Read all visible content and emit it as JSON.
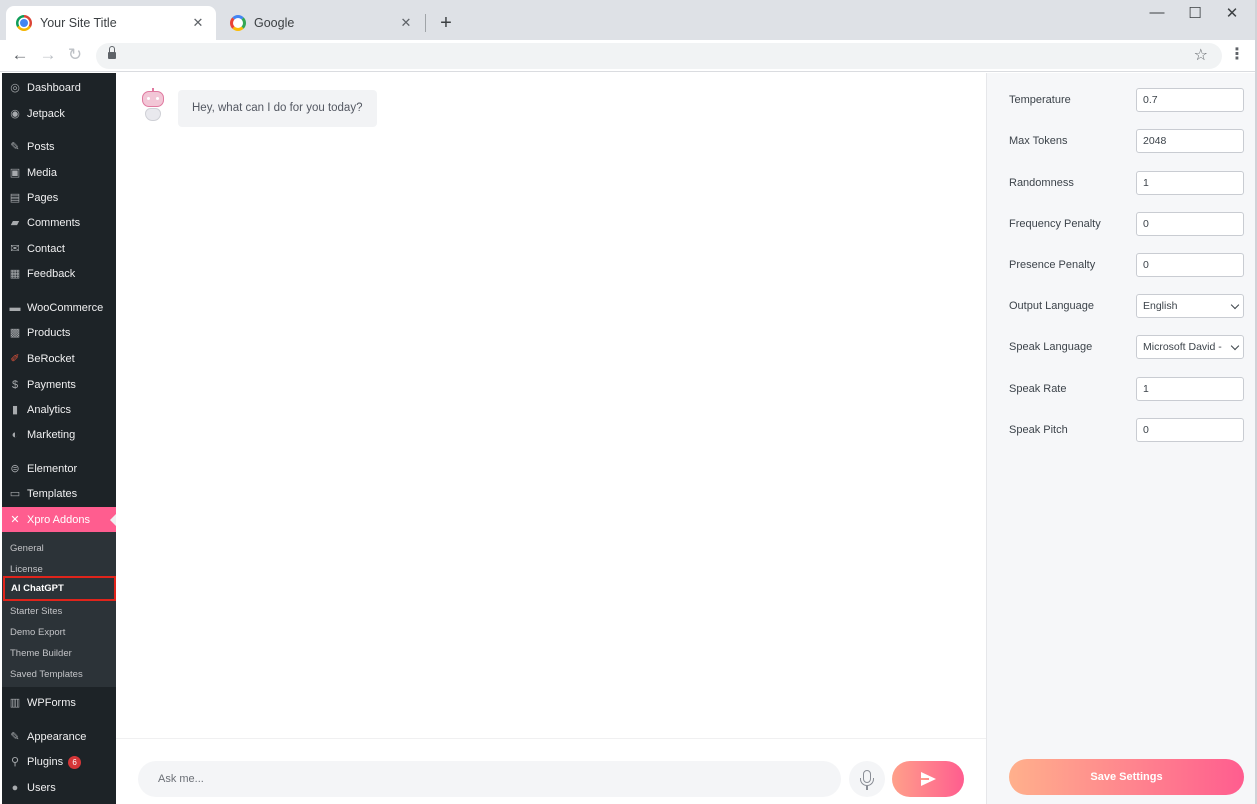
{
  "browser": {
    "tabs": [
      {
        "title": "Your Site Title",
        "icon": "chrome-icon",
        "close": "✕"
      },
      {
        "title": "Google",
        "icon": "google-icon",
        "close": "✕"
      }
    ],
    "new_tab": "+",
    "window": {
      "minimize": "—",
      "maximize": "☐",
      "close": "✕"
    },
    "nav": {
      "back": "←",
      "forward": "→",
      "reload": "↻",
      "star": "☆",
      "menu": "⋮"
    }
  },
  "sidebar": {
    "items": [
      {
        "label": "Dashboard",
        "icon": "◎"
      },
      {
        "label": "Jetpack",
        "icon": "◉"
      },
      {
        "label": "Posts",
        "icon": "✎"
      },
      {
        "label": "Media",
        "icon": "▣"
      },
      {
        "label": "Pages",
        "icon": "▤"
      },
      {
        "label": "Comments",
        "icon": "▰"
      },
      {
        "label": "Contact",
        "icon": "✉"
      },
      {
        "label": "Feedback",
        "icon": "▦"
      },
      {
        "label": "WooCommerce",
        "icon": "▬"
      },
      {
        "label": "Products",
        "icon": "▩"
      },
      {
        "label": "BeRocket",
        "icon": "✐"
      },
      {
        "label": "Payments",
        "icon": "$"
      },
      {
        "label": "Analytics",
        "icon": "▮"
      },
      {
        "label": "Marketing",
        "icon": "◐"
      },
      {
        "label": "Elementor",
        "icon": "⊜"
      },
      {
        "label": "Templates",
        "icon": "▭"
      },
      {
        "label": "Xpro Addons",
        "icon": "✕"
      },
      {
        "label": "WPForms",
        "icon": "▥"
      },
      {
        "label": "Appearance",
        "icon": "✎"
      },
      {
        "label": "Plugins",
        "icon": "⚲",
        "badge": "6"
      },
      {
        "label": "Users",
        "icon": "●"
      }
    ],
    "submenu": [
      "General",
      "License",
      "AI ChatGPT",
      "Starter Sites",
      "Demo Export",
      "Theme Builder",
      "Saved Templates"
    ]
  },
  "chat": {
    "greeting": "Hey, what can I do for you today?",
    "input_placeholder": "Ask me..."
  },
  "settings": {
    "fields": [
      {
        "label": "Temperature",
        "value": "0.7"
      },
      {
        "label": "Max Tokens",
        "value": "2048"
      },
      {
        "label": "Randomness",
        "value": "1"
      },
      {
        "label": "Frequency Penalty",
        "value": "0"
      },
      {
        "label": "Presence Penalty",
        "value": "0"
      },
      {
        "label": "Output Language",
        "value": "English"
      },
      {
        "label": "Speak Language",
        "value": "Microsoft David - E"
      },
      {
        "label": "Speak Rate",
        "value": "1"
      },
      {
        "label": "Speak Pitch",
        "value": "0"
      }
    ],
    "save_label": "Save Settings"
  },
  "colors": {
    "accent": "#ff5d8f",
    "sidebar_bg": "#1d2327",
    "highlight_border": "#e0241b"
  }
}
